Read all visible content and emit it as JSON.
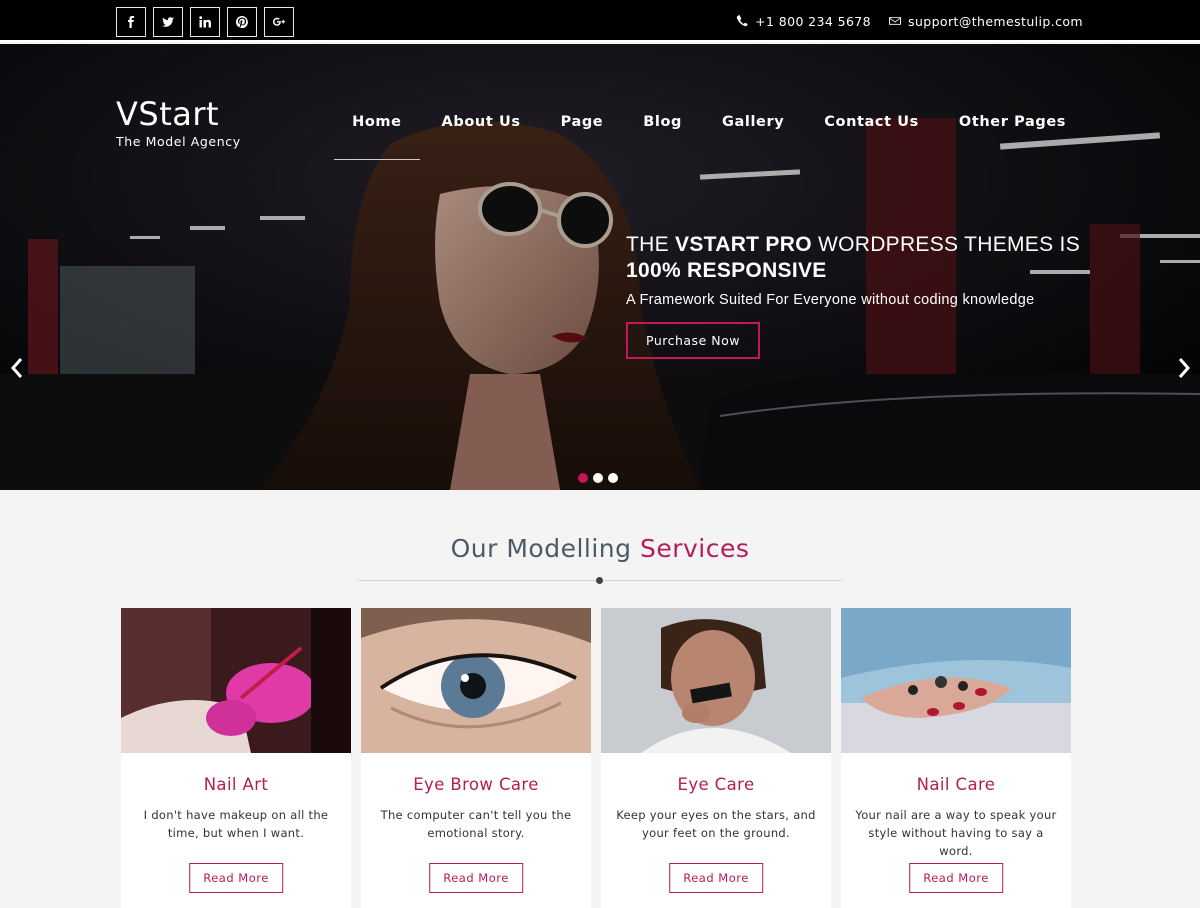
{
  "topbar": {
    "social": [
      {
        "icon": "facebook-icon",
        "glyph": "f"
      },
      {
        "icon": "twitter-icon",
        "glyph": "t"
      },
      {
        "icon": "linkedin-icon",
        "glyph": "in"
      },
      {
        "icon": "pinterest-icon",
        "glyph": "p"
      },
      {
        "icon": "google-plus-icon",
        "glyph": "g+"
      }
    ],
    "phone": "+1 800 234 5678",
    "email": "support@themestulip.com"
  },
  "header": {
    "logo": "VStart",
    "tagline": "The Model Agency",
    "nav": [
      {
        "label": "Home",
        "active": true
      },
      {
        "label": "About Us"
      },
      {
        "label": "Page"
      },
      {
        "label": "Blog"
      },
      {
        "label": "Gallery"
      },
      {
        "label": "Contact Us"
      },
      {
        "label": "Other Pages"
      }
    ]
  },
  "slider": {
    "heading_pre": "THE ",
    "heading_bold": "VSTART PRO",
    "heading_post": " WORDPRESS THEMES IS",
    "heading_line2": "100% RESPONSIVE",
    "subheading": "A Framework Suited For Everyone without coding knowledge",
    "button": "Purchase Now",
    "dots": 3,
    "active_dot": 0
  },
  "services": {
    "title_main": "Our Modelling ",
    "title_accent": "Services",
    "cards": [
      {
        "title": "Nail Art",
        "desc": "I don't have makeup on all the time, but when I want.",
        "button": "Read More"
      },
      {
        "title": "Eye Brow Care",
        "desc": "The computer can't tell you the emotional story.",
        "button": "Read More"
      },
      {
        "title": "Eye Care",
        "desc": "Keep your eyes on the stars, and your feet on the ground.",
        "button": "Read More"
      },
      {
        "title": "Nail Care",
        "desc": "Your nail are a way to speak your style without having to say a word.",
        "button": "Read More"
      }
    ]
  },
  "colors": {
    "accent": "#b51d58",
    "topbar": "#000000",
    "page_bg": "#f4f4f4"
  }
}
